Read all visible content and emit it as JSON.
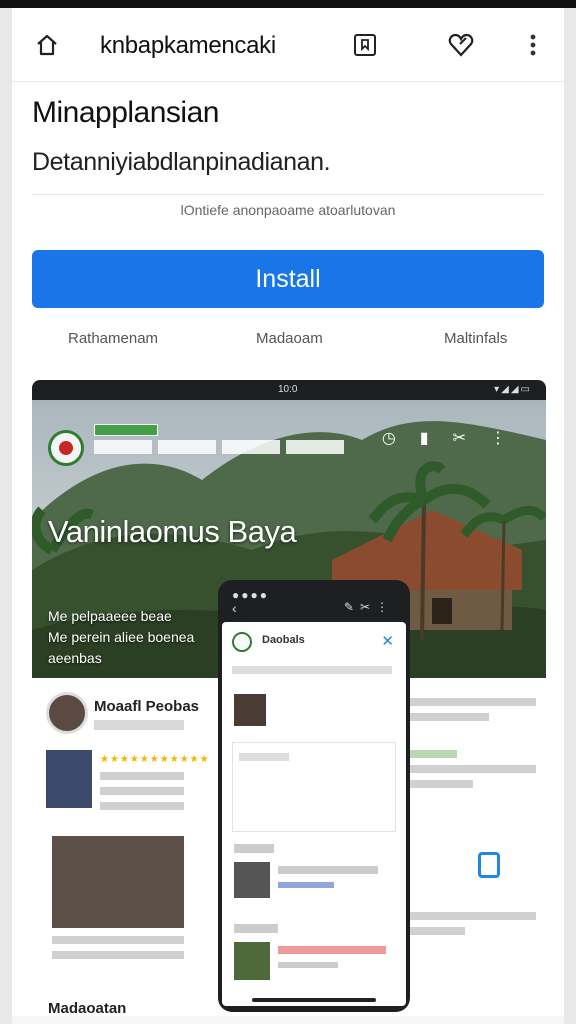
{
  "toolbar": {
    "title": "knbapkamencaki",
    "icons": [
      "home-icon",
      "bookmark-icon",
      "heart-icon",
      "more-vert-icon"
    ]
  },
  "app": {
    "name": "Minapplansian",
    "developer": "Detanniyiabdlanpinadianan.",
    "meta": "lOntiefe anonpaoame atoarlutovan",
    "install_label": "Install",
    "install_color": "#1976e8"
  },
  "stats": [
    "Rathamenam",
    "Madaoam",
    "Maltinfals"
  ],
  "screenshot": {
    "status_time": "10:0",
    "title": "Vaninlaomus Baya",
    "subtitle": "Me pelpaaeee beae\nMe perein aliee boenea\naeenbas",
    "feed_name": "Moaafl Peobas",
    "feed_caption": "Madaoatan",
    "phone_title": "Daobals"
  }
}
